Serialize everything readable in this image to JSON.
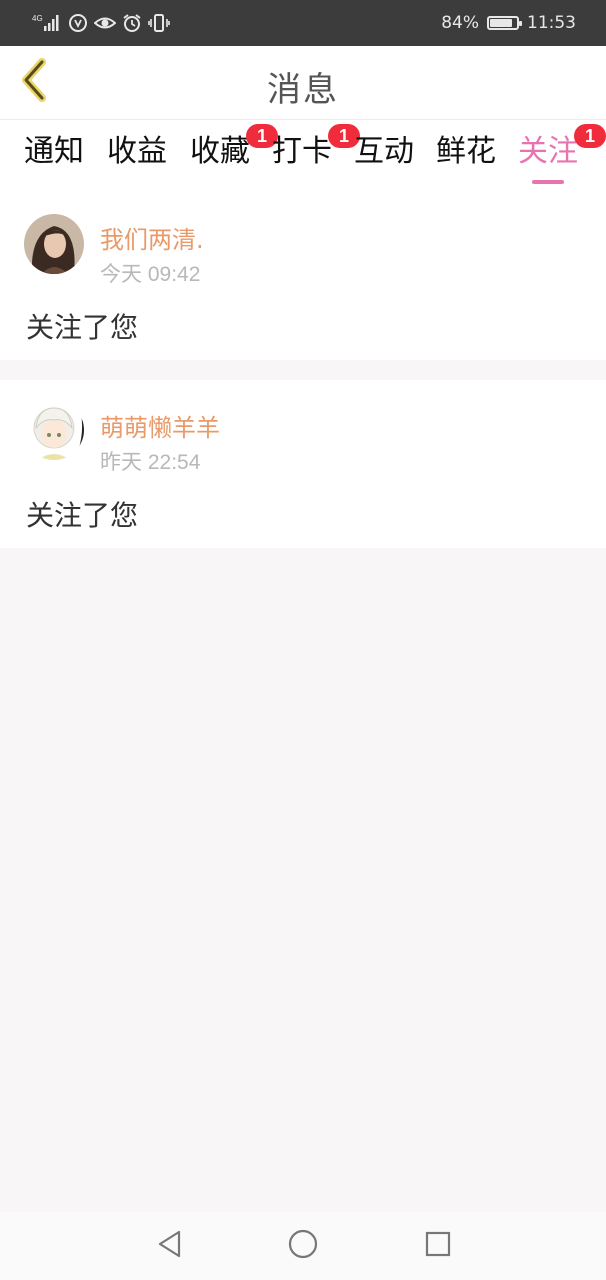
{
  "status_bar": {
    "network_label": "4G",
    "battery_percent": "84%",
    "battery_level": 0.84,
    "time": "11:53",
    "icons": [
      "signal-icon",
      "data-saver-icon",
      "eye-icon",
      "alarm-icon",
      "vibrate-icon",
      "battery-icon"
    ],
    "color": "#3c3c3c"
  },
  "header": {
    "title": "消息",
    "back_icon": "chevron-left-icon"
  },
  "tabs": [
    {
      "label": "通知",
      "badge": null,
      "active": false
    },
    {
      "label": "收益",
      "badge": null,
      "active": false
    },
    {
      "label": "收藏",
      "badge": "1",
      "active": false
    },
    {
      "label": "打卡",
      "badge": "1",
      "active": false
    },
    {
      "label": "互动",
      "badge": null,
      "active": false
    },
    {
      "label": "鲜花",
      "badge": null,
      "active": false
    },
    {
      "label": "关注",
      "badge": "1",
      "active": true
    }
  ],
  "messages": [
    {
      "user": "我们两清.",
      "time": "今天 09:42",
      "text": "关注了您"
    },
    {
      "user": "萌萌懒羊羊",
      "time": "昨天 22:54",
      "text": "关注了您"
    }
  ],
  "nav_bar": {
    "icons": [
      "back-triangle-icon",
      "home-circle-icon",
      "recents-square-icon"
    ]
  },
  "colors": {
    "accent_pink": "#e774b0",
    "username_orange": "#e89a6a",
    "badge_red": "#f02c3c",
    "page_bg": "#f8f6f7"
  }
}
